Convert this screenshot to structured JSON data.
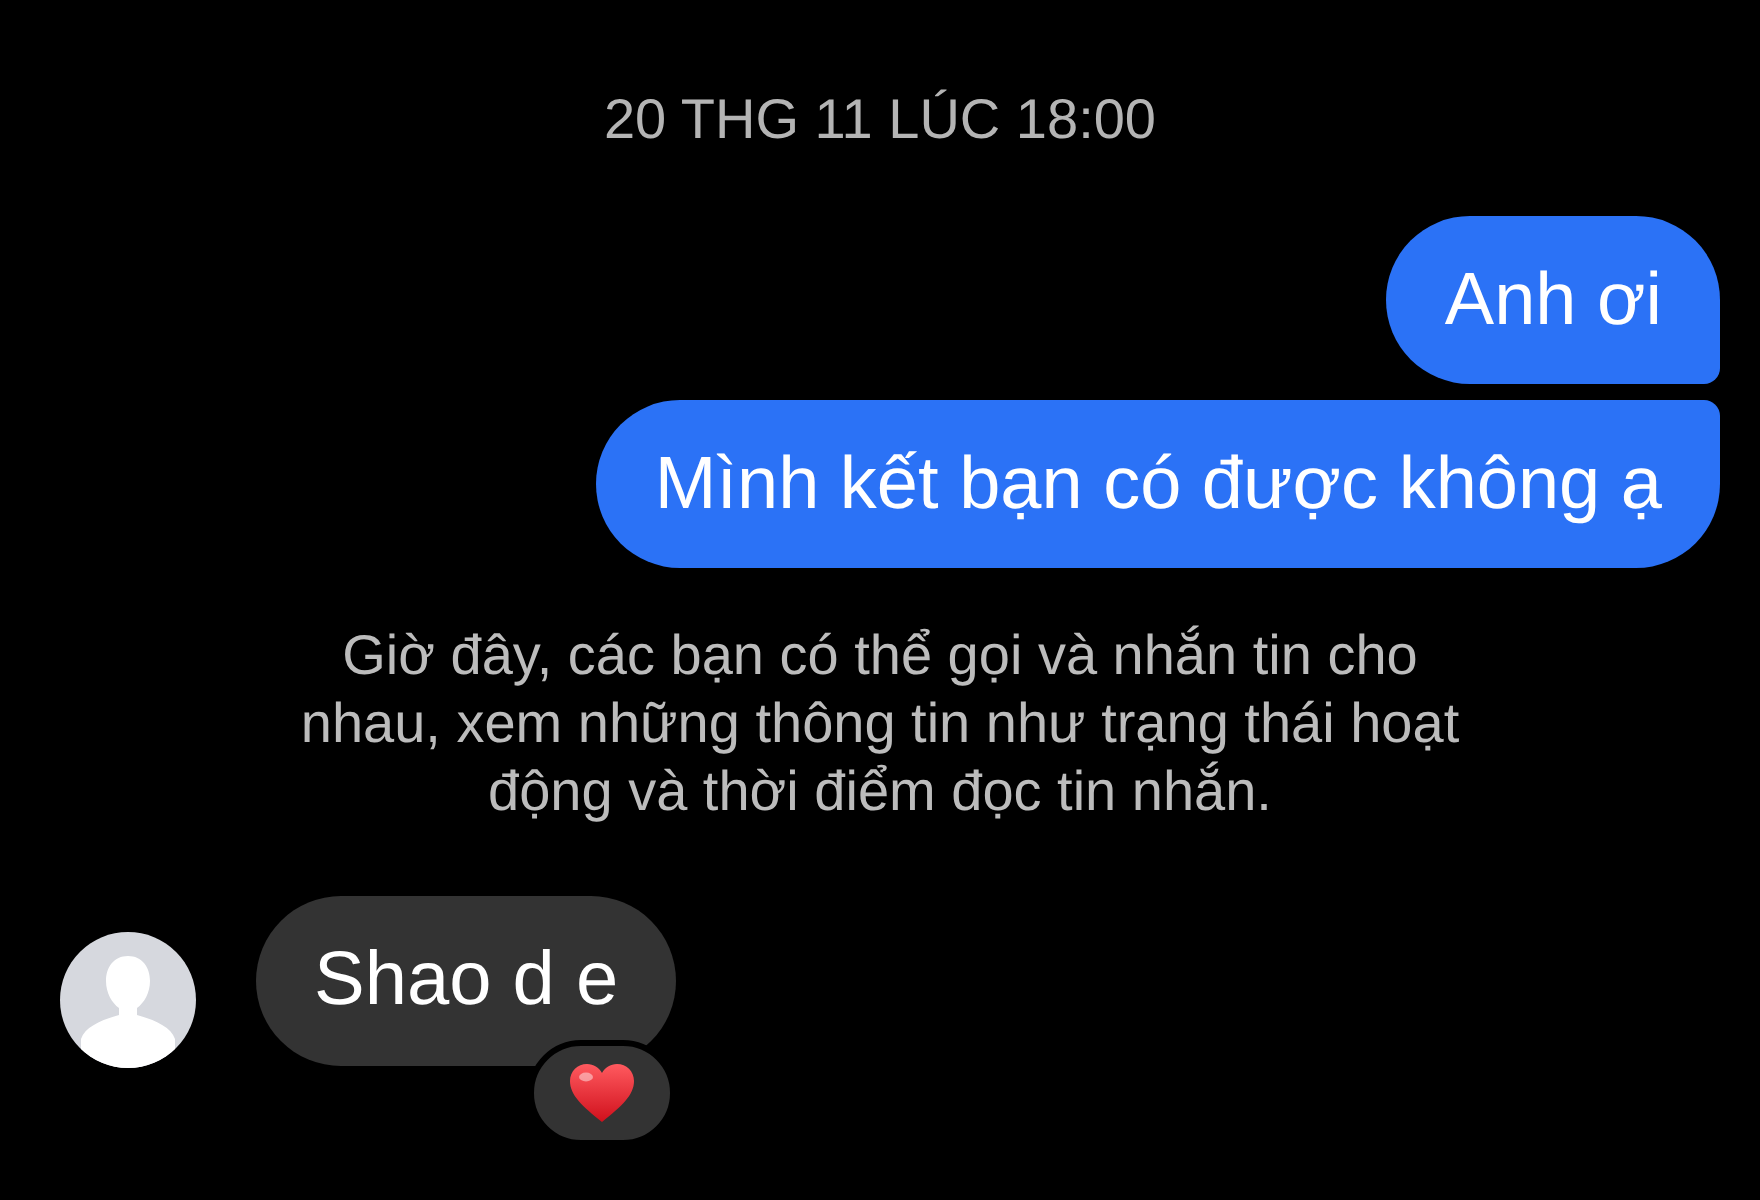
{
  "thread": [
    {
      "kind": "timestamp",
      "text": "20 THG 11 LÚC 18:00"
    },
    {
      "kind": "outgoing",
      "text": "Anh ơi"
    },
    {
      "kind": "outgoing",
      "text": "Mình kết bạn có được không ạ"
    },
    {
      "kind": "notice",
      "text": "Giờ đây, các bạn có thể gọi và nhắn tin cho nhau, xem những thông tin như trạng thái hoạt động và thời điểm đọc tin nhắn."
    },
    {
      "kind": "incoming",
      "text": "Shao d e",
      "reacted": true
    }
  ]
}
